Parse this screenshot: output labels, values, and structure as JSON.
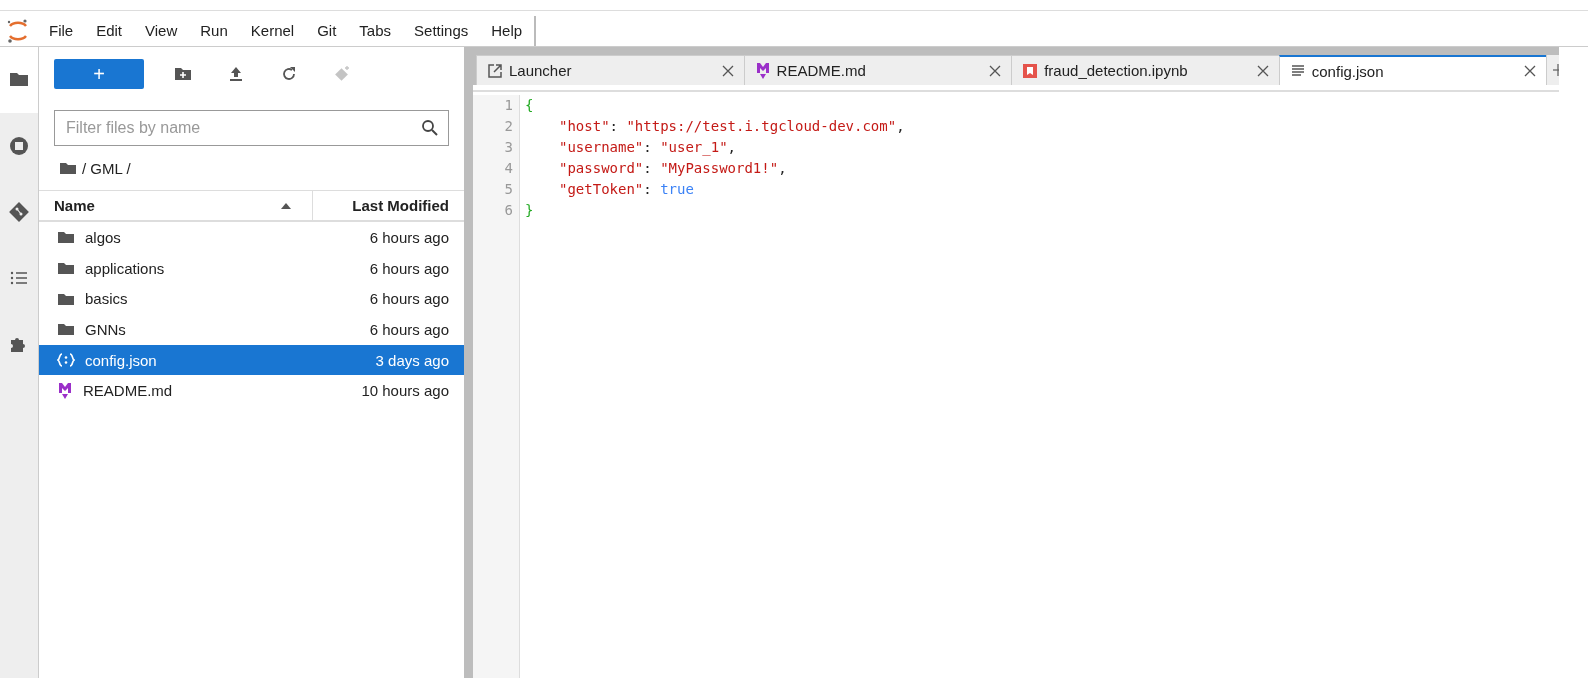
{
  "menu": [
    "File",
    "Edit",
    "View",
    "Run",
    "Kernel",
    "Git",
    "Tabs",
    "Settings",
    "Help"
  ],
  "activity_bar": [
    {
      "kind": "folder",
      "selected": true
    },
    {
      "kind": "stop",
      "selected": false
    },
    {
      "kind": "git",
      "selected": false
    },
    {
      "kind": "list",
      "selected": false
    },
    {
      "kind": "puzzle",
      "selected": false
    }
  ],
  "file_browser": {
    "new_button": "+",
    "filter": {
      "placeholder": "Filter files by name"
    },
    "breadcrumb": "/ GML /",
    "columns": [
      "Name",
      "Last Modified"
    ],
    "rows": [
      {
        "name": "algos",
        "modified": "6 hours ago",
        "kind": "folder",
        "selected": false
      },
      {
        "name": "applications",
        "modified": "6 hours ago",
        "kind": "folder",
        "selected": false
      },
      {
        "name": "basics",
        "modified": "6 hours ago",
        "kind": "folder",
        "selected": false
      },
      {
        "name": "GNNs",
        "modified": "6 hours ago",
        "kind": "folder",
        "selected": false
      },
      {
        "name": "config.json",
        "modified": "3 days ago",
        "kind": "json",
        "selected": true
      },
      {
        "name": "README.md",
        "modified": "10 hours ago",
        "kind": "markdown",
        "selected": false
      }
    ]
  },
  "tabs": [
    {
      "label": "Launcher",
      "kind": "launcher",
      "selected": false
    },
    {
      "label": "README.md",
      "kind": "markdown",
      "selected": false
    },
    {
      "label": "fraud_detection.ipynb",
      "kind": "notebook",
      "selected": false
    },
    {
      "label": "config.json",
      "kind": "text",
      "selected": true
    }
  ],
  "editor": {
    "lines": [
      {
        "number": "1",
        "tokens": [
          {
            "text": "{",
            "kind": "bracket"
          }
        ],
        "children": [
          {
            "number": "2",
            "tokens": [
              {
                "text": "\"host\"",
                "kind": "string"
              },
              {
                "text": ": ",
                "kind": "punct"
              },
              {
                "text": "\"https://test.i.tgcloud-dev.com\"",
                "kind": "string"
              },
              {
                "text": ",",
                "kind": "punct"
              }
            ]
          },
          {
            "number": "3",
            "tokens": [
              {
                "text": "\"username\"",
                "kind": "string"
              },
              {
                "text": ": ",
                "kind": "punct"
              },
              {
                "text": "\"user_1\"",
                "kind": "string"
              },
              {
                "text": ",",
                "kind": "punct"
              }
            ]
          },
          {
            "number": "4",
            "tokens": [
              {
                "text": "\"password\"",
                "kind": "string"
              },
              {
                "text": ": ",
                "kind": "punct"
              },
              {
                "text": "\"MyPassword1!\"",
                "kind": "string"
              },
              {
                "text": ",",
                "kind": "punct"
              }
            ]
          },
          {
            "number": "5",
            "tokens": [
              {
                "text": "\"getToken\"",
                "kind": "string"
              },
              {
                "text": ": ",
                "kind": "punct"
              },
              {
                "text": "true",
                "kind": "keyword"
              }
            ]
          }
        ]
      },
      {
        "number": "6",
        "tokens": [
          {
            "text": "}",
            "kind": "bracket"
          }
        ]
      }
    ]
  }
}
